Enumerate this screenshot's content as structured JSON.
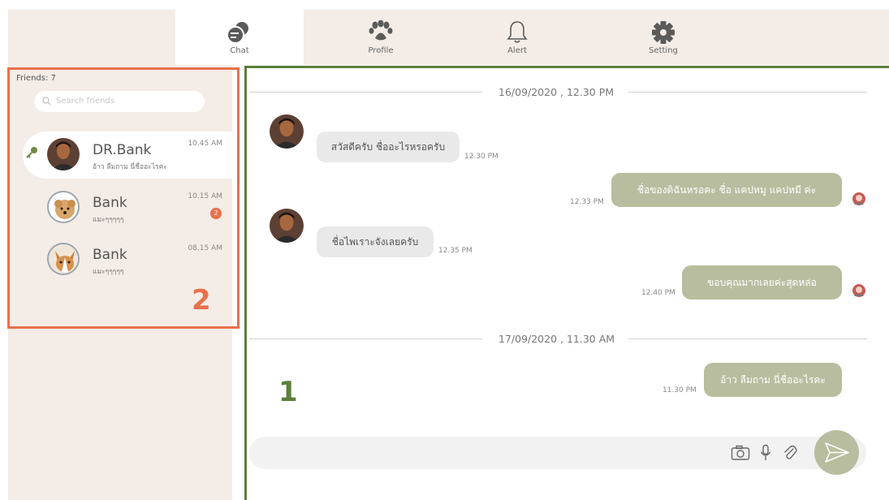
{
  "tabs": [
    {
      "label": "Chat",
      "icon": "chat-bubbles-icon",
      "active": true
    },
    {
      "label": "Profile",
      "icon": "paw-icon",
      "active": false
    },
    {
      "label": "Alert",
      "icon": "bell-icon",
      "active": false
    },
    {
      "label": "Setting",
      "icon": "gear-icon",
      "active": false
    }
  ],
  "sidebar": {
    "friends_count": "Friends: 7",
    "search_placeholder": "Search friends",
    "friends": [
      {
        "name": "DR.Bank",
        "preview": "อ้าว ลืมถาม นี่ชื่ออะไรคะ",
        "time": "10.45 AM",
        "active": true,
        "badge": ""
      },
      {
        "name": "Bank",
        "preview": "แมะๆๆๆๆๆ",
        "time": "10.15 AM",
        "active": false,
        "badge": "2"
      },
      {
        "name": "Bank",
        "preview": "แมะๆๆๆๆๆ",
        "time": "08.15 AM",
        "active": false,
        "badge": ""
      }
    ]
  },
  "annotations": {
    "box1": "1",
    "box2": "2"
  },
  "chat": {
    "date1": "16/09/2020 , 12.30 PM",
    "date2": "17/09/2020 , 11.30 AM",
    "messages": [
      {
        "dir": "in",
        "text": "สวัสดีครับ ชื่ออะไรหรอครับ",
        "time": "12.30 PM"
      },
      {
        "dir": "out",
        "text": "ชื่อของดิฉันหรอคะ ชื่อ แคปหมู แคปหมี ค่ะ",
        "time": "12.33 PM"
      },
      {
        "dir": "in",
        "text": "ชื่อไพเราะจังเลยครับ",
        "time": "12.35 PM"
      },
      {
        "dir": "out",
        "text": "ขอบคุณมากเลยค่ะสุดหล่อ",
        "time": "12.40 PM"
      },
      {
        "dir": "out",
        "text": "อ้าว ลืมถาม นี่ชื่ออะไรคะ",
        "time": "11.30 PM"
      }
    ]
  },
  "composer": {
    "icons": [
      "camera-icon",
      "microphone-icon",
      "paperclip-icon",
      "send-icon"
    ]
  },
  "colors": {
    "accent_green": "#b9bd9f",
    "border_green": "#5b7f3b",
    "border_orange": "#e8714c",
    "panel": "#f4ece6"
  }
}
